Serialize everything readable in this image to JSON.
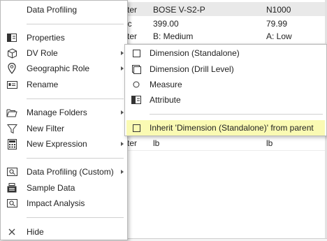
{
  "grid": {
    "rows": [
      [
        "cter",
        "BOSE V-S2-P",
        "N1000"
      ],
      [
        "ric",
        "399.00",
        "79.99"
      ],
      [
        "cter",
        "B: Medium",
        "A: Low"
      ],
      [
        "",
        "",
        ""
      ],
      [
        "",
        "",
        ""
      ],
      [
        "",
        "",
        ""
      ],
      [
        "",
        "",
        ""
      ],
      [
        "",
        "",
        ""
      ],
      [
        "cter",
        "lb",
        "lb"
      ]
    ]
  },
  "menu": {
    "items": [
      {
        "label": "Data Profiling",
        "icon": "none",
        "submenu": false
      },
      {
        "label": "Properties",
        "icon": "properties-icon",
        "submenu": false
      },
      {
        "label": "DV Role",
        "icon": "cube-icon",
        "submenu": true
      },
      {
        "label": "Geographic Role",
        "icon": "map-pin-icon",
        "submenu": true
      },
      {
        "label": "Rename",
        "icon": "rename-icon",
        "submenu": false
      },
      {
        "label": "Manage Folders",
        "icon": "folder-icon",
        "submenu": true
      },
      {
        "label": "New Filter",
        "icon": "filter-icon",
        "submenu": false
      },
      {
        "label": "New Expression",
        "icon": "calculator-icon",
        "submenu": true
      },
      {
        "label": "Data Profiling (Custom)",
        "icon": "profiling-icon",
        "submenu": true
      },
      {
        "label": "Sample Data",
        "icon": "sample-data-icon",
        "submenu": false
      },
      {
        "label": "Impact Analysis",
        "icon": "impact-icon",
        "submenu": false
      },
      {
        "label": "Hide",
        "icon": "close-icon",
        "submenu": false
      }
    ]
  },
  "submenu": {
    "items": [
      {
        "label": "Dimension (Standalone)",
        "icon": "square-icon"
      },
      {
        "label": "Dimension (Drill Level)",
        "icon": "stacked-square-icon"
      },
      {
        "label": "Measure",
        "icon": "circle-icon"
      },
      {
        "label": "Attribute",
        "icon": "attribute-icon"
      },
      {
        "label": "Inherit 'Dimension (Standalone)' from parent",
        "icon": "square-icon",
        "highlighted": true
      }
    ],
    "highlight_color": "#fafab3"
  }
}
